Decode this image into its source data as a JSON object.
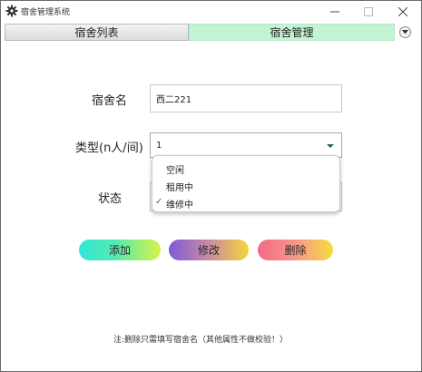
{
  "window": {
    "title": "宿舍管理系统"
  },
  "tabs": [
    {
      "label": "宿舍列表",
      "active": false
    },
    {
      "label": "宿舍管理",
      "active": true
    }
  ],
  "form": {
    "name_label": "宿舍名",
    "name_value": "西二221",
    "type_label": "类型(n人/间)",
    "type_value": "1",
    "status_label": "状态",
    "status_options": [
      "空闲",
      "租用中",
      "维修中"
    ],
    "status_selected": "维修中"
  },
  "buttons": {
    "add": "添加",
    "edit": "修改",
    "delete": "删除"
  },
  "note": "注:删除只需填写宿舍名（其他属性不做校验！）",
  "colors": {
    "active_tab": "#c2f3d2",
    "check": "#2e7d32"
  }
}
